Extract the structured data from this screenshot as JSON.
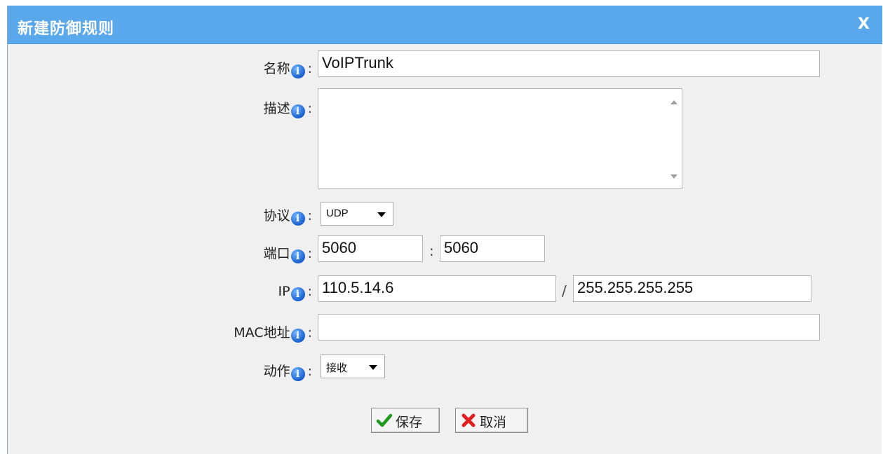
{
  "dialog": {
    "title": "新建防御规则",
    "close_label": "X"
  },
  "form": {
    "name": {
      "label": "名称",
      "value": "VoIPTrunk"
    },
    "description": {
      "label": "描述",
      "value": ""
    },
    "protocol": {
      "label": "协议",
      "value": "UDP"
    },
    "port": {
      "label": "端口",
      "start": "5060",
      "separator": ":",
      "end": "5060"
    },
    "ip": {
      "label": "IP",
      "address": "110.5.14.6",
      "separator": "/",
      "mask": "255.255.255.255"
    },
    "mac": {
      "label": "MAC地址",
      "value": ""
    },
    "action": {
      "label": "动作",
      "value": "接收"
    }
  },
  "buttons": {
    "save": "保存",
    "cancel": "取消"
  },
  "icons": {
    "info": "info-icon",
    "check": "check-icon",
    "cross": "cross-icon"
  },
  "colors": {
    "titlebar": "#5aa8ec",
    "background": "#f0f0f0",
    "info_icon": "#1a61d0",
    "check": "#1f9a1f",
    "cross": "#e02020"
  }
}
